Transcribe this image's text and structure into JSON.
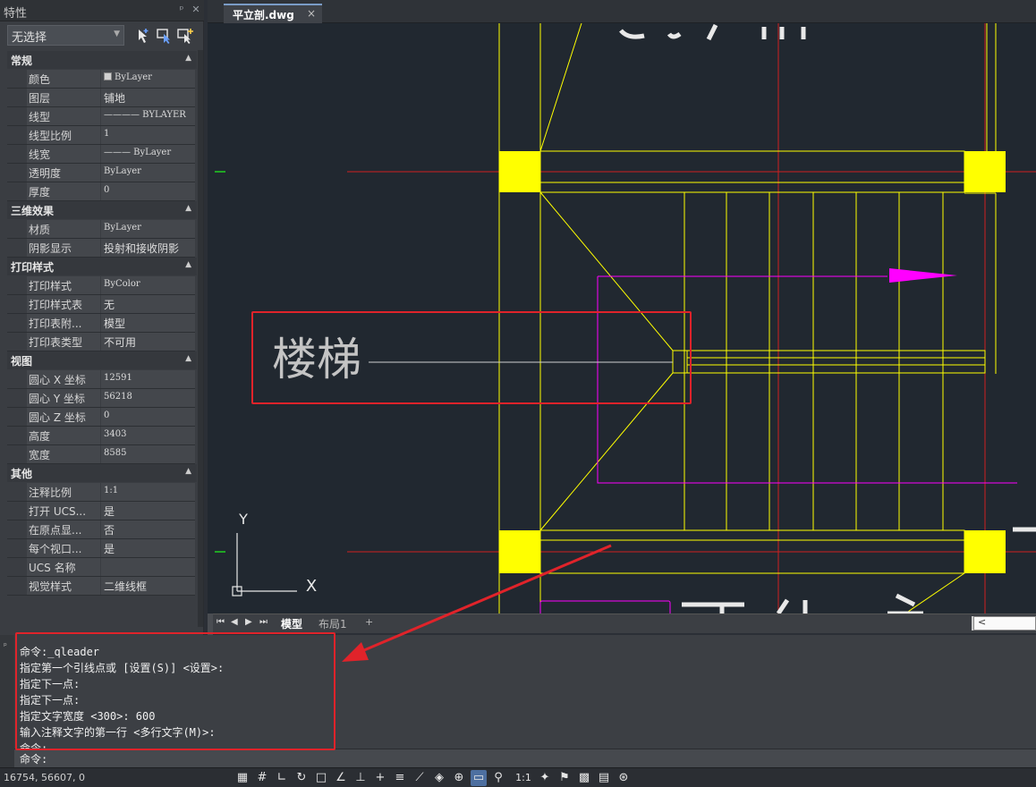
{
  "properties_panel": {
    "title": "特性",
    "selection": "无选择",
    "sections": [
      {
        "name": "常规",
        "rows": [
          {
            "name": "颜色",
            "value": "ByLayer"
          },
          {
            "name": "图层",
            "value": "铺地"
          },
          {
            "name": "线型",
            "value": "———— BYLAYER"
          },
          {
            "name": "线型比例",
            "value": "1"
          },
          {
            "name": "线宽",
            "value": "——— ByLayer"
          },
          {
            "name": "透明度",
            "value": "ByLayer"
          },
          {
            "name": "厚度",
            "value": "0"
          }
        ]
      },
      {
        "name": "三维效果",
        "rows": [
          {
            "name": "材质",
            "value": "ByLayer"
          },
          {
            "name": "阴影显示",
            "value": "投射和接收阴影"
          }
        ]
      },
      {
        "name": "打印样式",
        "rows": [
          {
            "name": "打印样式",
            "value": "ByColor"
          },
          {
            "name": "打印样式表",
            "value": "无"
          },
          {
            "name": "打印表附...",
            "value": "模型"
          },
          {
            "name": "打印表类型",
            "value": "不可用"
          }
        ]
      },
      {
        "name": "视图",
        "rows": [
          {
            "name": "圆心 X 坐标",
            "value": "12591"
          },
          {
            "name": "圆心 Y 坐标",
            "value": "56218"
          },
          {
            "name": "圆心 Z 坐标",
            "value": "0"
          },
          {
            "name": "高度",
            "value": "3403"
          },
          {
            "name": "宽度",
            "value": "8585"
          }
        ]
      },
      {
        "name": "其他",
        "rows": [
          {
            "name": "注释比例",
            "value": "1:1"
          },
          {
            "name": "打开 UCS...",
            "value": "是"
          },
          {
            "name": "在原点显...",
            "value": "否"
          },
          {
            "name": "每个视口...",
            "value": "是"
          },
          {
            "name": "UCS 名称",
            "value": ""
          },
          {
            "name": "视觉样式",
            "value": "二维线框"
          }
        ]
      }
    ]
  },
  "document_tab": {
    "label": "平立剖.dwg",
    "close": "×"
  },
  "drawing": {
    "annotation_text": "楼梯",
    "ucs_y_label": "Y",
    "ucs_x_label": "X"
  },
  "layout_tabs": {
    "nav": [
      "⏮",
      "◀",
      "▶",
      "⏭"
    ],
    "tabs": [
      "模型",
      "布局1"
    ],
    "add": "+",
    "scroll_left": "<"
  },
  "command": {
    "history": [
      "命令:_qleader",
      "指定第一个引线点或 [设置(S)] <设置>:",
      "指定下一点:",
      "指定下一点:",
      "指定文字宽度 <300>: 600",
      "输入注释文字的第一行 <多行文字(M)>:",
      "命令:"
    ],
    "prompt": "命令:"
  },
  "status": {
    "coordinates": "16754, 56607, 0",
    "annotation_scale": "1:1"
  },
  "colors": {
    "canvas_bg": "#212830",
    "yellow": "#ffff00",
    "red": "#e0232a",
    "magenta": "#ff00ff"
  }
}
